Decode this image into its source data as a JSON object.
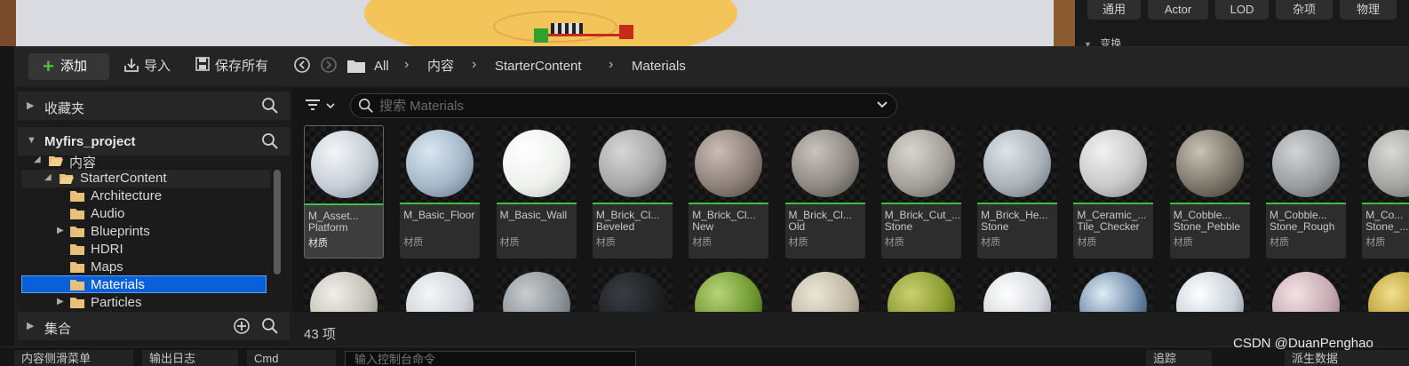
{
  "details": {
    "tabs": [
      "通用",
      "Actor",
      "LOD",
      "杂项",
      "物理"
    ],
    "section": "变换"
  },
  "toolbar": {
    "add_label": "添加",
    "import_label": "导入",
    "save_all_label": "保存所有",
    "breadcrumbs": [
      "All",
      "内容",
      "StarterContent",
      "Materials"
    ]
  },
  "sources": {
    "favorites": "收藏夹",
    "project": "Myfirs_project",
    "collections": "集合",
    "tree": [
      {
        "label": "内容",
        "expanded": true
      },
      {
        "label": "StarterContent",
        "expanded": true
      },
      {
        "label": "Architecture"
      },
      {
        "label": "Audio"
      },
      {
        "label": "Blueprints",
        "has_children": true
      },
      {
        "label": "HDRI"
      },
      {
        "label": "Maps"
      },
      {
        "label": "Materials",
        "selected": true
      },
      {
        "label": "Particles",
        "has_children": true
      }
    ]
  },
  "assets": {
    "search_placeholder": "搜索 Materials",
    "count_label": "43 项",
    "items": [
      {
        "name1": "M_Asset...",
        "name2": "Platform",
        "type": "材质",
        "colors": [
          "#f4f6f8",
          "#c5ced6",
          "#7d8790"
        ]
      },
      {
        "name1": "M_Basic_Floor",
        "name2": "",
        "type": "材质",
        "colors": [
          "#dbe6f0",
          "#a5b8ca",
          "#5f7080"
        ]
      },
      {
        "name1": "M_Basic_Wall",
        "name2": "",
        "type": "材质",
        "colors": [
          "#ffffff",
          "#eef1ee",
          "#b9bdb8"
        ]
      },
      {
        "name1": "M_Brick_Cl...",
        "name2": "Beveled",
        "type": "材质",
        "colors": [
          "#d6d6d6",
          "#a8a8a8",
          "#5c5c5c"
        ]
      },
      {
        "name1": "M_Brick_Cl...",
        "name2": "New",
        "type": "材质",
        "colors": [
          "#c9bdb5",
          "#8e817a",
          "#4a403b"
        ]
      },
      {
        "name1": "M_Brick_Cl...",
        "name2": "Old",
        "type": "材质",
        "colors": [
          "#c8c4bd",
          "#8f8a82",
          "#4a4742"
        ]
      },
      {
        "name1": "M_Brick_Cut_...",
        "name2": "Stone",
        "type": "材质",
        "colors": [
          "#d8d5cf",
          "#a5a19a",
          "#5c5a55"
        ]
      },
      {
        "name1": "M_Brick_He...",
        "name2": "Stone",
        "type": "材质",
        "colors": [
          "#dfe4e8",
          "#aab3ba",
          "#616a72"
        ]
      },
      {
        "name1": "M_Ceramic_...",
        "name2": "Tile_Checker",
        "type": "材质",
        "colors": [
          "#f2f2f2",
          "#c9c9c9",
          "#7c7c7c"
        ]
      },
      {
        "name1": "M_Cobble...",
        "name2": "Stone_Pebble",
        "type": "材质",
        "colors": [
          "#c8c2b6",
          "#7e776b",
          "#3a352e"
        ]
      },
      {
        "name1": "M_Cobble...",
        "name2": "Stone_Rough",
        "type": "材质",
        "colors": [
          "#d2d4d6",
          "#9b9ea1",
          "#55585b"
        ]
      },
      {
        "name1": "M_Co...",
        "name2": "Stone_...",
        "type": "材质",
        "colors": [
          "#d8d8d4",
          "#a4a4a0",
          "#5d5d5a"
        ]
      }
    ],
    "row2_colors": [
      [
        "#f0efe8",
        "#c4c1b8",
        "#7a776f"
      ],
      [
        "#f4f6f8",
        "#d0d4d8",
        "#8a8f94"
      ],
      [
        "#c8cccf",
        "#8f9498",
        "#4c5054"
      ],
      [
        "#3a3e42",
        "#1e2124",
        "#0a0b0c"
      ],
      [
        "#b8d27a",
        "#6f9a30",
        "#2e4a10"
      ],
      [
        "#ece6d8",
        "#c0b8a6",
        "#7a7362"
      ],
      [
        "#c8d070",
        "#8a9a30",
        "#444d10"
      ],
      [
        "#ffffff",
        "#d4d8dc",
        "#7a8088"
      ],
      [
        "#e0ecf6",
        "#6e8aa8",
        "#1e2e40"
      ],
      [
        "#ffffff",
        "#c8d0d8",
        "#6a747e"
      ],
      [
        "#f2e2e6",
        "#c8aab2",
        "#7a626a"
      ],
      [
        "#f0e090",
        "#b89a30",
        "#6a5410"
      ]
    ]
  },
  "bottombar": {
    "tab1": "内容侧滑菜单",
    "tab2": "输出日志",
    "tab3": "Cmd",
    "console_placeholder": "输入控制台命令",
    "right1": "派生数据",
    "right2": "追踪"
  },
  "watermark": "CSDN @DuanPenghao"
}
